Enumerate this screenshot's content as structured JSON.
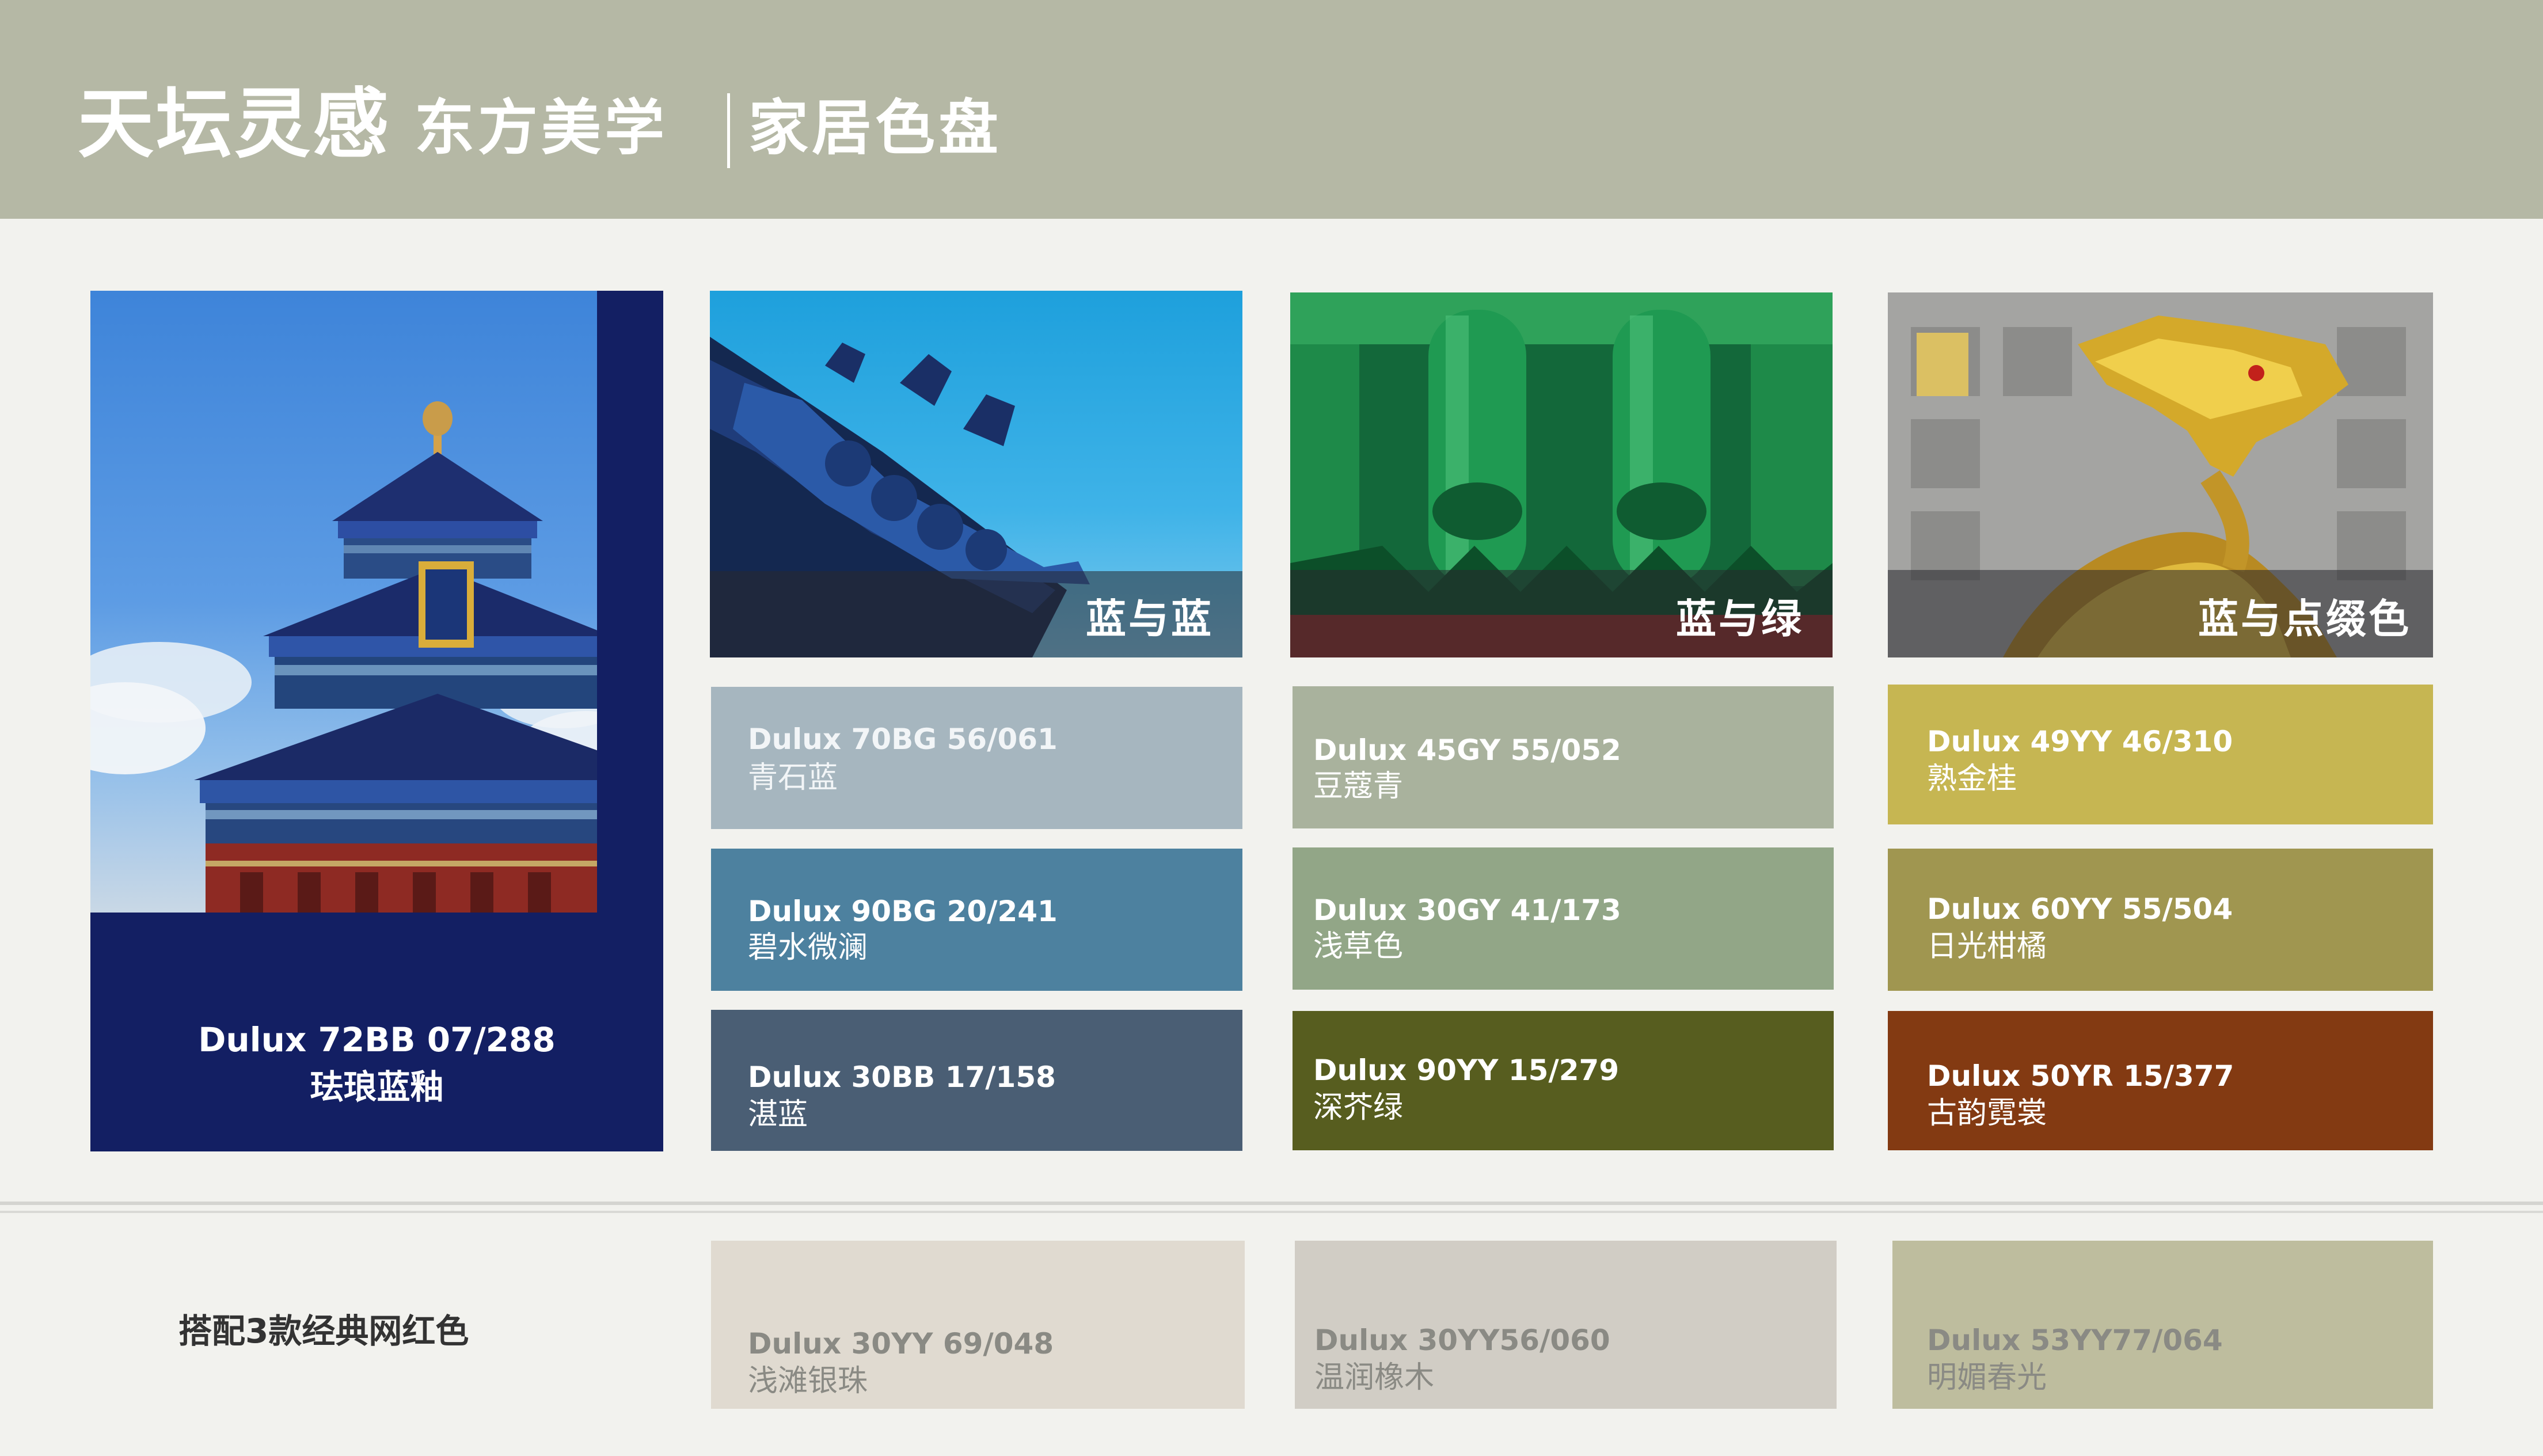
{
  "header": {
    "title": "天坛灵感",
    "subtitle_left": "东方美学",
    "subtitle_right": "家居色盘"
  },
  "hero": {
    "code": "Dulux 72BB 07/288",
    "name": "珐琅蓝釉",
    "color": "#131f63"
  },
  "themes": [
    {
      "label": "蓝与蓝",
      "swatches": [
        {
          "code": "Dulux 70BG 56/061",
          "name": "青石蓝",
          "color": "#a6b6bf"
        },
        {
          "code": "Dulux  90BG 20/241",
          "name": "碧水微澜",
          "color": "#4d819f"
        },
        {
          "code": "Dulux 30BB 17/158",
          "name": "湛蓝",
          "color": "#4a5e74"
        }
      ]
    },
    {
      "label": "蓝与绿",
      "swatches": [
        {
          "code": "Dulux 45GY 55/052",
          "name": "豆蔻青",
          "color": "#a9b29d"
        },
        {
          "code": "Dulux 30GY 41/173",
          "name": "浅草色",
          "color": "#92a687"
        },
        {
          "code": "Dulux 90YY 15/279",
          "name": "深芥绿",
          "color": "#575d1f"
        }
      ]
    },
    {
      "label": "蓝与点缀色",
      "swatches": [
        {
          "code": "Dulux 49YY 46/310",
          "name": "熟金桂",
          "color": "#c6b652"
        },
        {
          "code": "Dulux 60YY 55/504",
          "name": "日光柑橘",
          "color": "#a09650"
        },
        {
          "code": "Dulux 50YR 15/377",
          "name": "古韵霓裳",
          "color": "#833a12"
        }
      ]
    }
  ],
  "footer": {
    "label": "搭配3款经典网红色",
    "swatches": [
      {
        "code": "Dulux 30YY 69/048",
        "name": "浅滩银珠",
        "color": "#e0dad0"
      },
      {
        "code": "Dulux 30YY56/060",
        "name": "温润橡木",
        "color": "#d1cdc5"
      },
      {
        "code": "Dulux 53YY77/064",
        "name": "明媚春光",
        "color": "#bebd9e"
      }
    ]
  }
}
